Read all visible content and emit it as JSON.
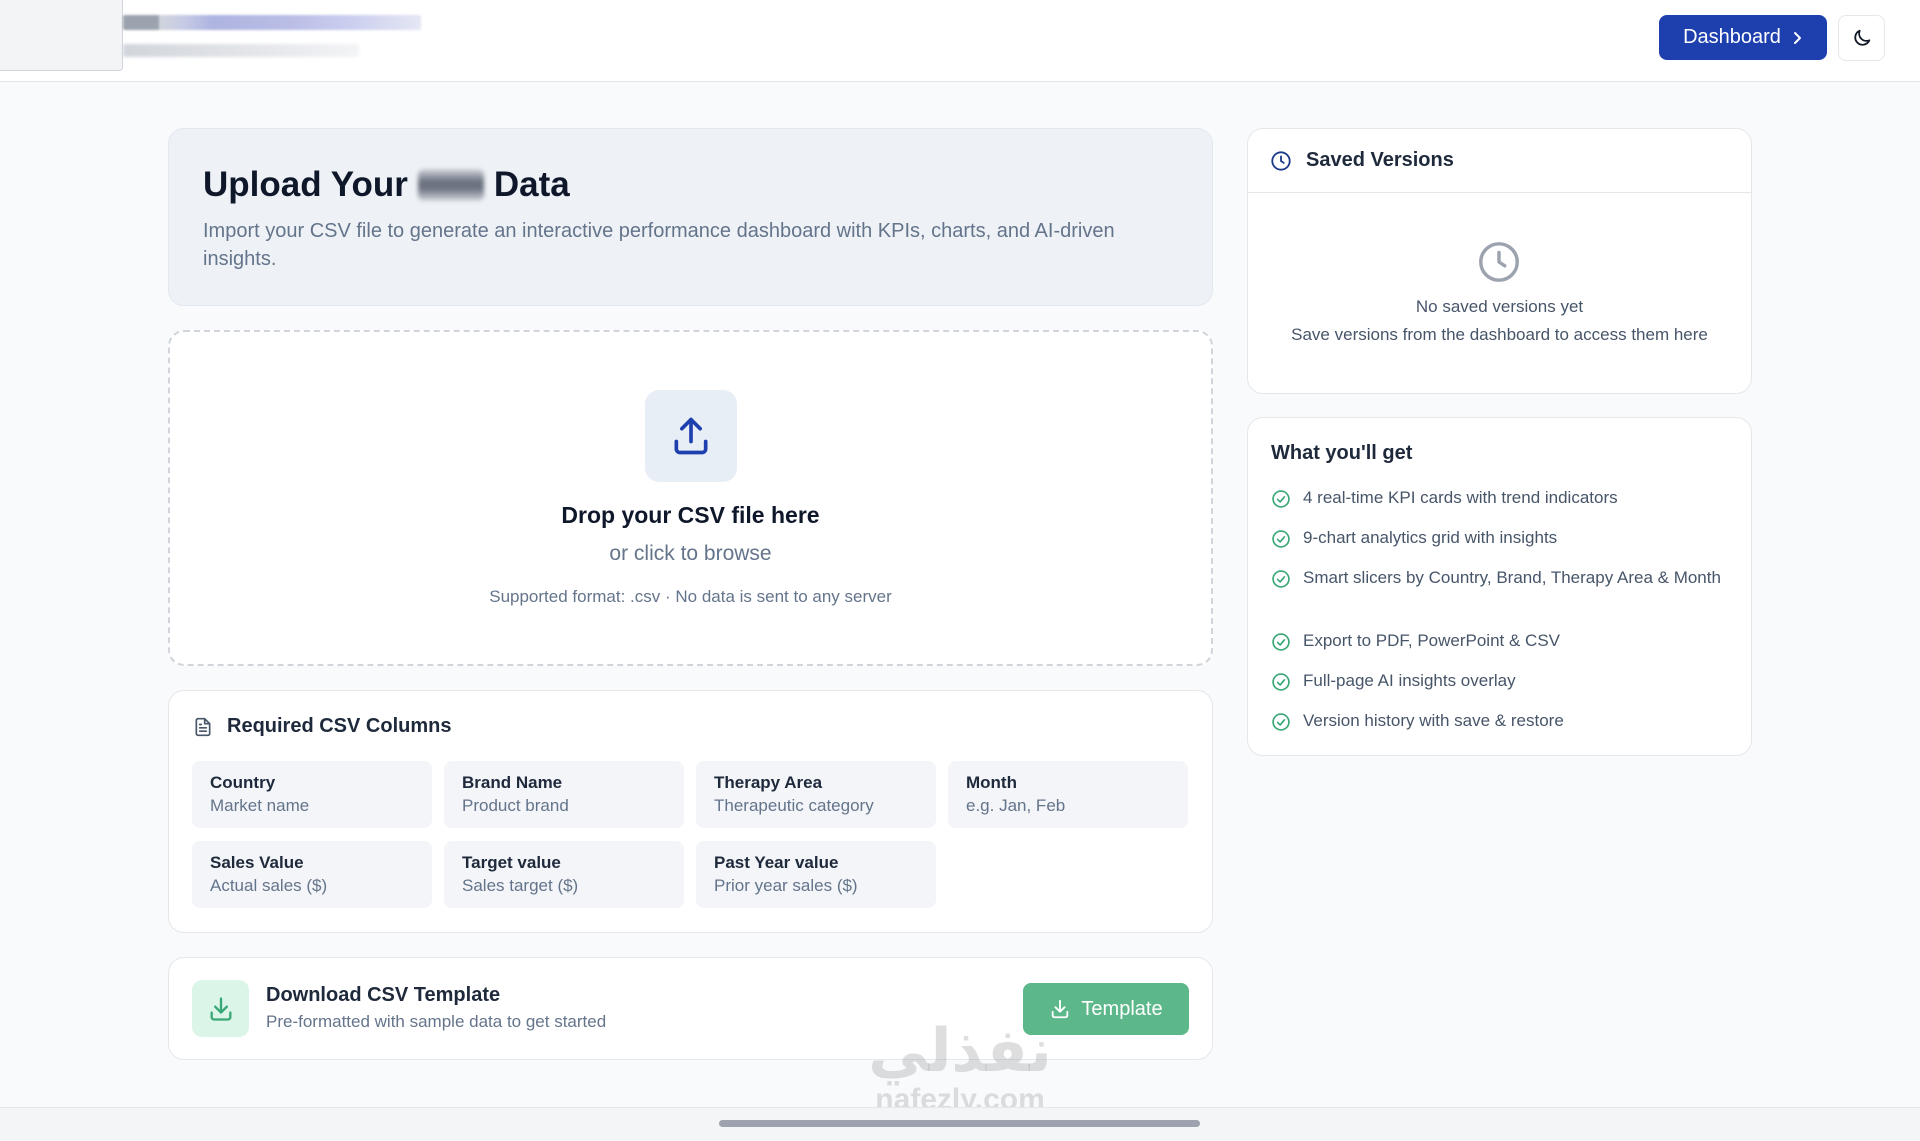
{
  "header": {
    "dashboard_label": "Dashboard",
    "icons": {
      "chevron": "chevron-right-icon",
      "theme": "moon-icon"
    }
  },
  "hero": {
    "title_before": "Upload Your",
    "title_after": "Data",
    "subtitle": "Import your CSV file to generate an interactive performance dashboard with KPIs, charts, and AI-driven insights."
  },
  "dropzone": {
    "title": "Drop your CSV file here",
    "subtitle": "or click to browse",
    "note": "Supported format: .csv · No data is sent to any server"
  },
  "required": {
    "title": "Required CSV Columns",
    "columns": [
      {
        "name": "Country",
        "desc": "Market name"
      },
      {
        "name": "Brand Name",
        "desc": "Product brand"
      },
      {
        "name": "Therapy Area",
        "desc": "Therapeutic category"
      },
      {
        "name": "Month",
        "desc": "e.g. Jan, Feb"
      },
      {
        "name": "Sales Value",
        "desc": "Actual sales ($)"
      },
      {
        "name": "Target value",
        "desc": "Sales target ($)"
      },
      {
        "name": "Past Year value",
        "desc": "Prior year sales ($)"
      }
    ]
  },
  "download": {
    "title": "Download CSV Template",
    "subtitle": "Pre-formatted with sample data to get started",
    "button_label": "Template"
  },
  "versions": {
    "title": "Saved Versions",
    "empty_title": "No saved versions yet",
    "empty_sub": "Save versions from the dashboard to access them here"
  },
  "features": {
    "title": "What you'll get",
    "items": [
      "4 real-time KPI cards with trend indicators",
      "9-chart analytics grid with insights",
      "Smart slicers by Country, Brand, Therapy Area & Month",
      "Export to PDF, PowerPoint & CSV",
      "Full-page AI insights overlay",
      "Version history with save & restore"
    ]
  },
  "watermark": {
    "arabic": "نفذلي",
    "latin": "nafezly.com"
  },
  "colors": {
    "primary": "#1e40af",
    "success": "#5cb88a",
    "check": "#3aa876",
    "muted_text": "#64748b",
    "background": "#f8fafc"
  }
}
